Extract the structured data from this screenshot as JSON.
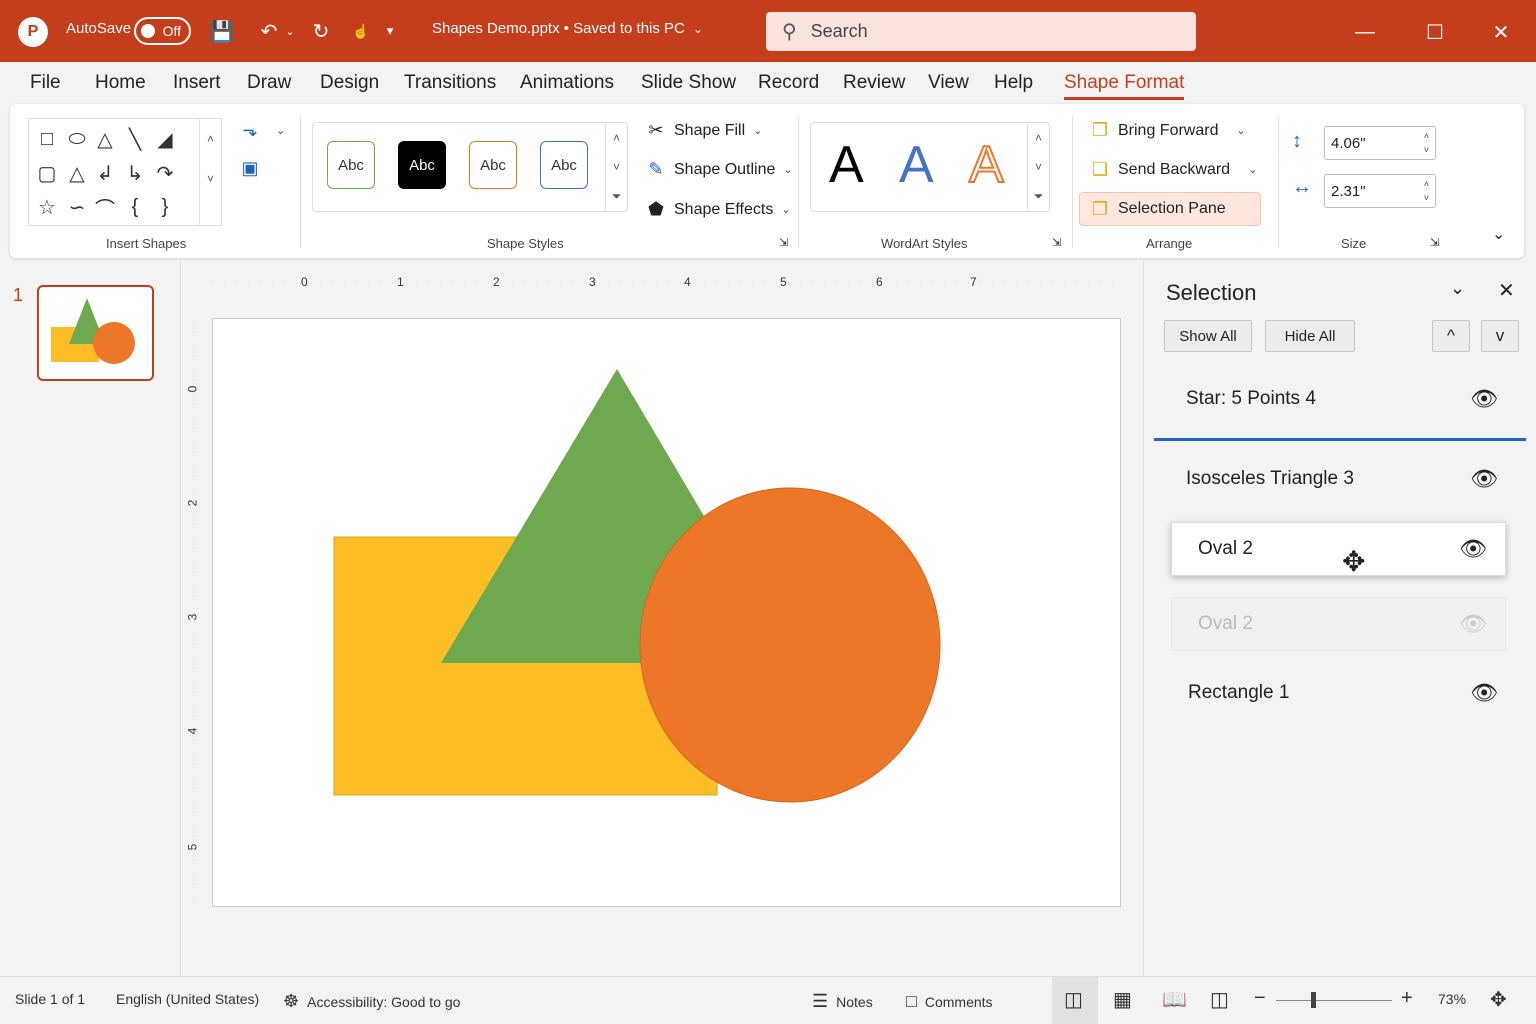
{
  "titlebar": {
    "autosave_label": "AutoSave",
    "autosave_state": "Off",
    "document_title": "Shapes Demo.pptx • Saved to this PC",
    "search_placeholder": "Search",
    "brand_color": "#c43e1c"
  },
  "menu": {
    "items": [
      "File",
      "Home",
      "Insert",
      "Draw",
      "Design",
      "Transitions",
      "Animations",
      "Slide Show",
      "Record",
      "Review",
      "View",
      "Help",
      "Shape Format"
    ],
    "active": "Shape Format"
  },
  "ribbon": {
    "groups": {
      "insert_shapes": "Insert Shapes",
      "shape_styles": "Shape Styles",
      "wordart_styles": "WordArt Styles",
      "arrange": "Arrange",
      "size": "Size"
    },
    "style_swatches": [
      "Abc",
      "Abc",
      "Abc",
      "Abc"
    ],
    "shape_fill": "Shape Fill",
    "shape_outline": "Shape Outline",
    "shape_effects": "Shape Effects",
    "wordart_samples": [
      "A",
      "A",
      "A"
    ],
    "bring_forward": "Bring Forward",
    "send_backward": "Send Backward",
    "selection_pane": "Selection Pane",
    "height_value": "4.06\"",
    "width_value": "2.31\""
  },
  "thumbnails": {
    "slide_number": "1"
  },
  "rulers": {
    "horizontal": [
      "0",
      "1",
      "2",
      "3",
      "4",
      "5",
      "6",
      "7"
    ],
    "vertical": [
      "0",
      "2",
      "3",
      "4",
      "5"
    ]
  },
  "slide_shapes": {
    "rectangle_color": "#fdbd24",
    "triangle_color": "#6ea84f",
    "oval_color": "#ed7728"
  },
  "selection_pane": {
    "title": "Selection",
    "show_all": "Show All",
    "hide_all": "Hide All",
    "move_up": "^",
    "move_down": "v",
    "items": [
      "Star: 5 Points 4",
      "Isosceles Triangle 3",
      "Oval 2",
      "Oval 2",
      "Rectangle 1"
    ]
  },
  "status": {
    "slide_info": "Slide 1 of 1",
    "language": "English (United States)",
    "accessibility": "Accessibility: Good to go",
    "notes": "Notes",
    "comments": "Comments",
    "zoom": "73%"
  }
}
